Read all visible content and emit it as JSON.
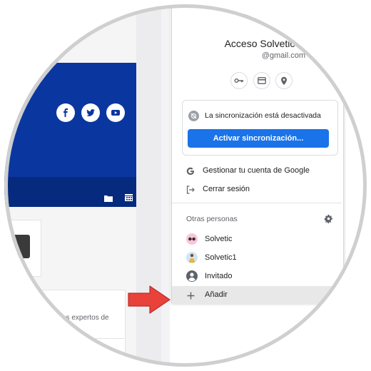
{
  "social": [
    "facebook-icon",
    "twitter-icon",
    "youtube-icon"
  ],
  "site": {
    "card_text": "es expertos de"
  },
  "account": {
    "name": "Acceso Solvetic",
    "email": "@gmail.com"
  },
  "account_actions": [
    "passwords-key-icon",
    "payment-card-icon",
    "location-pin-icon"
  ],
  "sync": {
    "status": "La sincronización está desactivada",
    "button": "Activar sincronización..."
  },
  "menu": {
    "manage": "Gestionar tu cuenta de Google",
    "signout": "Cerrar sesión"
  },
  "others": {
    "title": "Otras personas",
    "profiles": [
      "Solvetic",
      "Solvetic1",
      "Invitado"
    ],
    "add": "Añadir"
  },
  "colors": {
    "accent": "#1a73e8",
    "banner": "#0a36a0",
    "arrow": "#e8423a",
    "avatar": "#6a62d8"
  }
}
